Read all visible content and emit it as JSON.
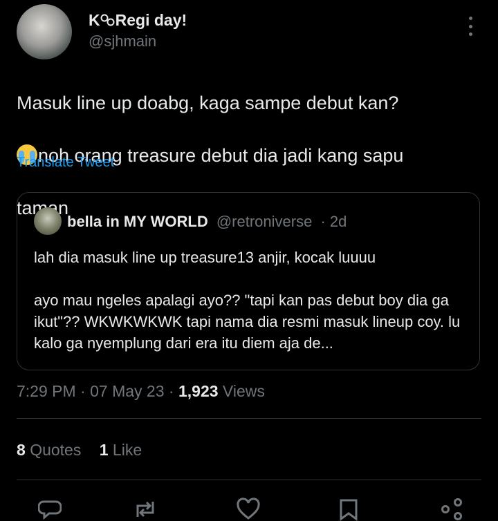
{
  "author": {
    "name": "KₒₒRegi day!",
    "name_prefix": "K",
    "name_suffix": "Regi day!",
    "handle": "@sjhmain"
  },
  "tweet": {
    "line1": "Masuk line up doabg, kaga sampe debut kan?",
    "line2": "noh orang treasure debut dia jadi kang sapu",
    "line3": "taman",
    "translate_label": "Translate Tweet"
  },
  "quoted": {
    "name": "bella in MY WORLD",
    "handle": "@retroniverse",
    "separator": "·",
    "time": "2d",
    "text": "lah dia masuk line up treasure13 anjir, kocak luuuu\n\nayo mau ngeles apalagi ayo?? \"tapi kan pas debut boy dia ga ikut\"?? WKWKWKWK tapi nama dia resmi masuk lineup coy. lu kalo ga nyemplung dari era itu diem aja de..."
  },
  "meta": {
    "time": "7:29 PM",
    "separator": "·",
    "date": "07 May 23",
    "views_count": "1,923",
    "views_label": "Views"
  },
  "stats": {
    "quotes_count": "8",
    "quotes_label": "Quotes",
    "likes_count": "1",
    "likes_label": "Like"
  },
  "colors": {
    "background": "#000000",
    "text": "#e7e9ea",
    "secondary": "#71767b",
    "link": "#1d9bf0",
    "border": "#2f3336"
  }
}
